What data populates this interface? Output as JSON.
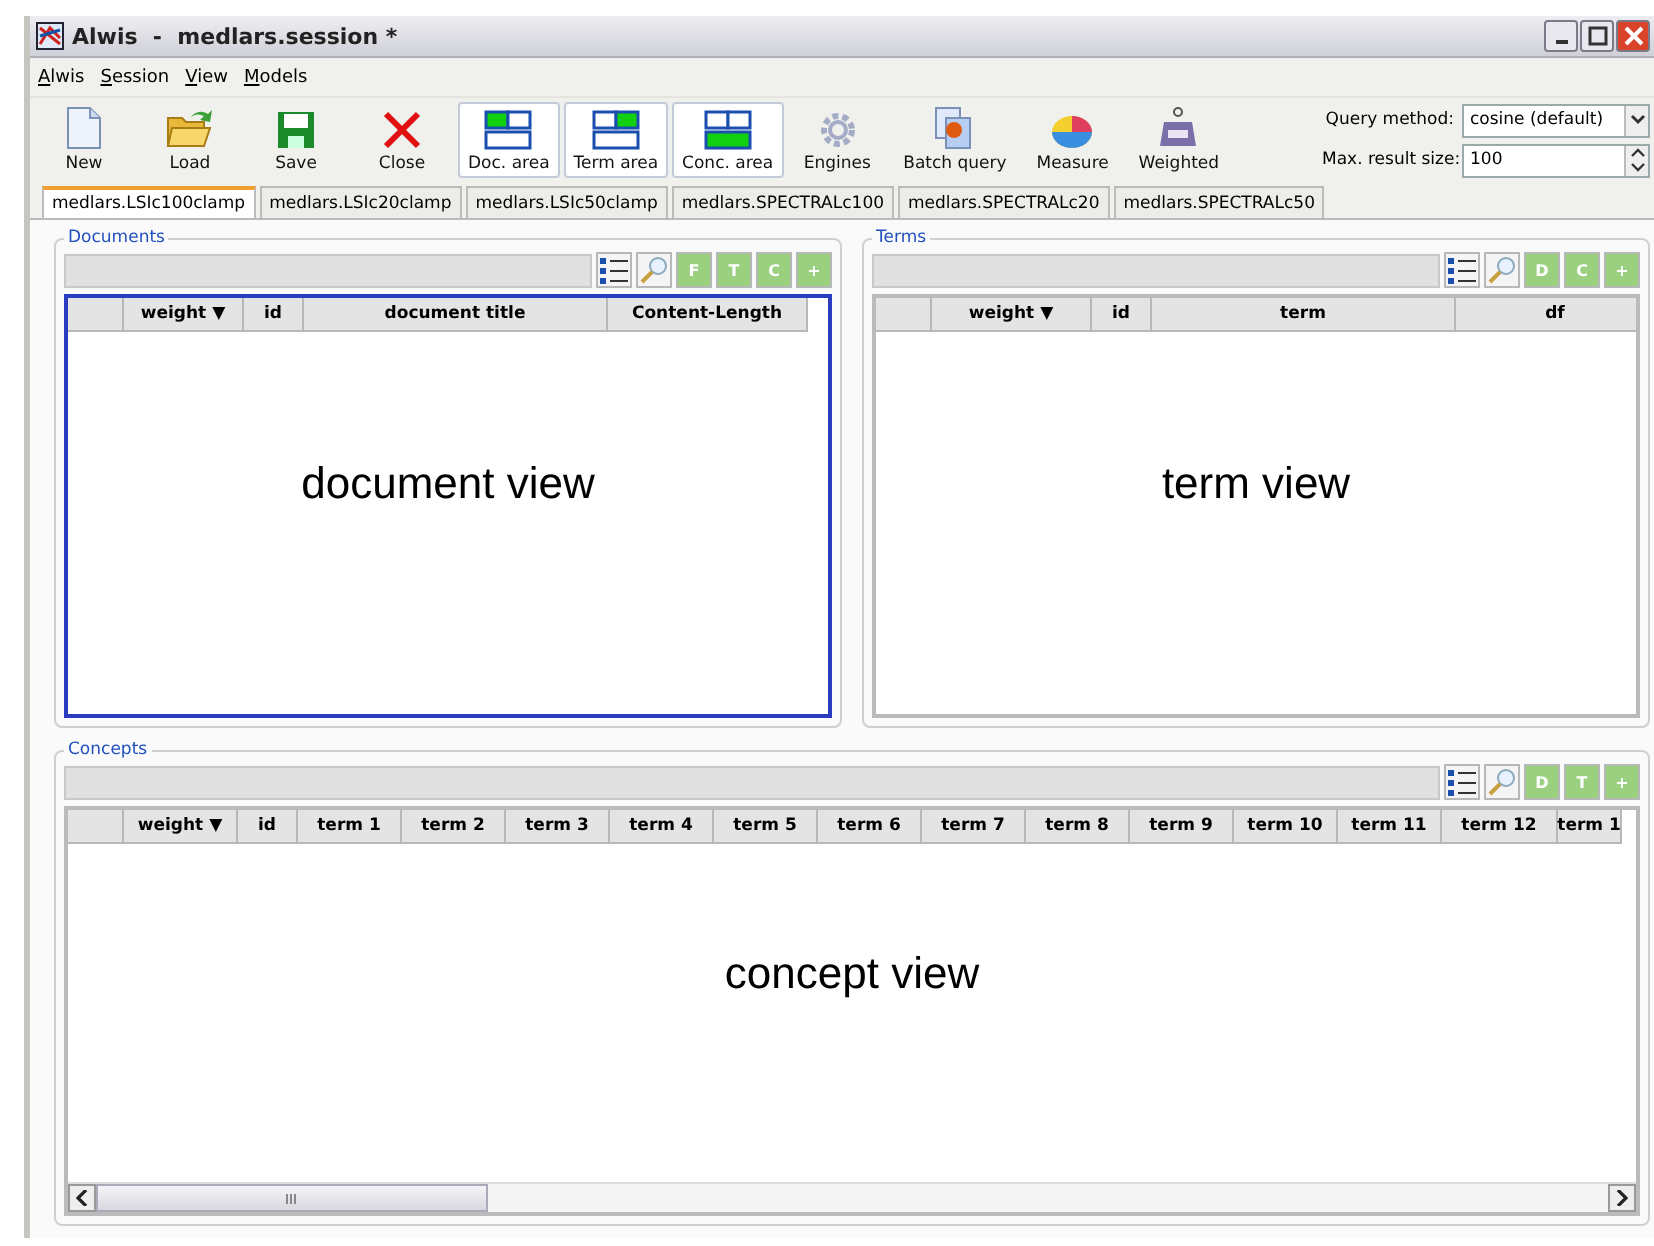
{
  "window": {
    "title": "Alwis  -  medlars.session *"
  },
  "menu": [
    "Alwis",
    "Session",
    "View",
    "Models"
  ],
  "toolbar": [
    {
      "label": "New",
      "kind": "new",
      "toggle": false
    },
    {
      "label": "Load",
      "kind": "load",
      "toggle": false
    },
    {
      "label": "Save",
      "kind": "save",
      "toggle": false
    },
    {
      "label": "Close",
      "kind": "close",
      "toggle": false
    },
    {
      "label": "Doc. area",
      "kind": "doc-area",
      "toggle": true
    },
    {
      "label": "Term area",
      "kind": "term-area",
      "toggle": true
    },
    {
      "label": "Conc. area",
      "kind": "conc-area",
      "toggle": true
    },
    {
      "label": "Engines",
      "kind": "engines",
      "toggle": false
    },
    {
      "label": "Batch query",
      "kind": "batch",
      "toggle": false
    },
    {
      "label": "Measure",
      "kind": "measure",
      "toggle": false
    },
    {
      "label": "Weighted",
      "kind": "weighted",
      "toggle": false
    }
  ],
  "query": {
    "method_label": "Query method:",
    "method": "cosine (default)",
    "size_label": "Max. result size:",
    "size": "100"
  },
  "tabs": [
    {
      "label": "medlars.LSIc100clamp",
      "selected": true
    },
    {
      "label": "medlars.LSIc20clamp",
      "selected": false
    },
    {
      "label": "medlars.LSIc50clamp",
      "selected": false
    },
    {
      "label": "medlars.SPECTRALc100",
      "selected": false
    },
    {
      "label": "medlars.SPECTRALc20",
      "selected": false
    },
    {
      "label": "medlars.SPECTRALc50",
      "selected": false
    }
  ],
  "panels": [
    {
      "title": "Documents",
      "focused": true,
      "buttons": [
        "F",
        "T",
        "C",
        "+"
      ],
      "columns": [
        "weight ▼",
        "id",
        "document title",
        "Content-Length"
      ],
      "view_label": "document view",
      "scrollbar": false
    },
    {
      "title": "Terms",
      "focused": false,
      "buttons": [
        "D",
        "C",
        "+"
      ],
      "columns": [
        "weight ▼",
        "id",
        "term",
        "df"
      ],
      "view_label": "term view",
      "scrollbar": false
    },
    {
      "title": "Concepts",
      "focused": false,
      "buttons": [
        "D",
        "T",
        "+"
      ],
      "columns": [
        "weight ▼",
        "id",
        "term 1",
        "term 2",
        "term 3",
        "term 4",
        "term 5",
        "term 6",
        "term 7",
        "term 8",
        "term 9",
        "term 10",
        "term 11",
        "term 12",
        "term 1"
      ],
      "view_label": "concept view",
      "scrollbar": true
    }
  ]
}
